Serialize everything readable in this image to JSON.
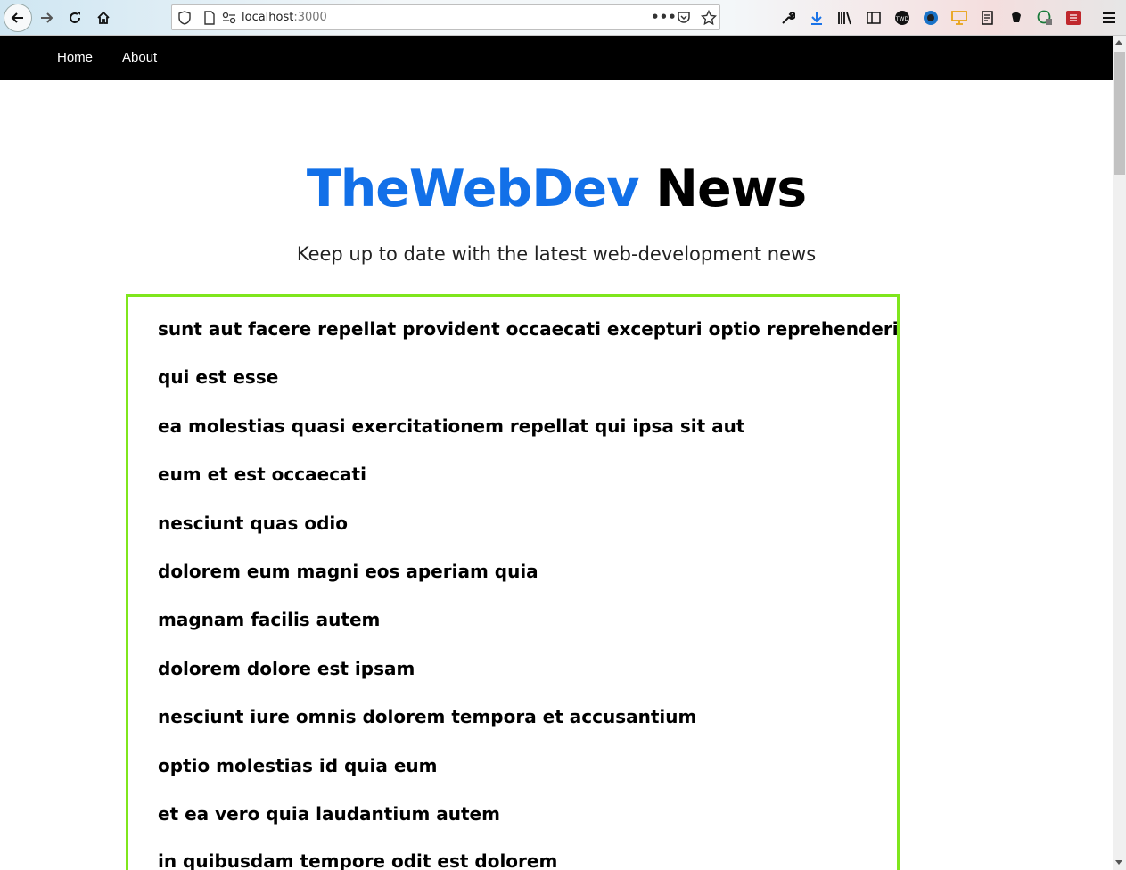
{
  "browser": {
    "url_host": "localhost",
    "url_port": ":3000"
  },
  "nav": {
    "links": [
      "Home",
      "About"
    ]
  },
  "header": {
    "title_brand": "TheWebDev",
    "title_rest": "News",
    "subtitle": "Keep up to date with the latest web-development news"
  },
  "news": {
    "items": [
      "sunt aut facere repellat provident occaecati excepturi optio reprehenderit",
      "qui est esse",
      "ea molestias quasi exercitationem repellat qui ipsa sit aut",
      "eum et est occaecati",
      "nesciunt quas odio",
      "dolorem eum magni eos aperiam quia",
      "magnam facilis autem",
      "dolorem dolore est ipsam",
      "nesciunt iure omnis dolorem tempora et accusantium",
      "optio molestias id quia eum",
      "et ea vero quia laudantium autem",
      "in quibusdam tempore odit est dolorem"
    ]
  },
  "colors": {
    "brand_blue": "#1270e8",
    "box_border": "#7fe61c",
    "navbar": "#000000"
  }
}
